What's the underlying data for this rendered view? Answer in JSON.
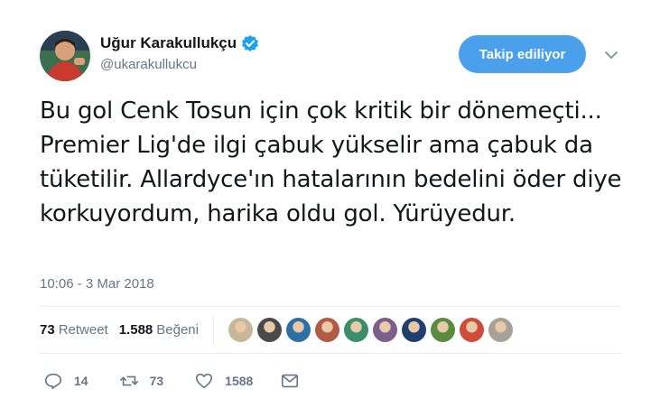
{
  "user": {
    "display_name": "Uğur Karakullukçu",
    "handle": "@ukarakullukcu",
    "verified": true
  },
  "follow_button": {
    "label": "Takip ediliyor"
  },
  "tweet": {
    "text": "Bu gol Cenk Tosun için çok kritik bir dönemeçti... Premier Lig'de ilgi çabuk yükselir ama çabuk da tüketilir. Allardyce'ın hatalarının bedelini öder diye korkuyordum, harika oldu gol. Yürüyedur.",
    "timestamp": "10:06 - 3 Mar 2018"
  },
  "stats": {
    "retweets": {
      "count": "73",
      "label": "Retweet"
    },
    "likes": {
      "count": "1.588",
      "label": "Beğeni"
    }
  },
  "likers": [
    {
      "color": "#c9b79a"
    },
    {
      "color": "#4a4a4a"
    },
    {
      "color": "#2f6fa8"
    },
    {
      "color": "#b35a46"
    },
    {
      "color": "#3a8f6a"
    },
    {
      "color": "#7a5f8a"
    },
    {
      "color": "#1f3f6f"
    },
    {
      "color": "#5c8a3f"
    },
    {
      "color": "#d04b3a"
    },
    {
      "color": "#a8a197"
    }
  ],
  "actions": {
    "reply_count": "14",
    "retweet_count": "73",
    "like_count": "1588"
  },
  "colors": {
    "accent": "#4aa0ea",
    "text": "#14171a",
    "secondary": "#657786",
    "divider": "#e6ecf0",
    "verified": "#1da1f2"
  },
  "icons": [
    "verified-badge-icon",
    "chevron-down-icon",
    "reply-icon",
    "retweet-icon",
    "heart-icon",
    "envelope-icon"
  ]
}
